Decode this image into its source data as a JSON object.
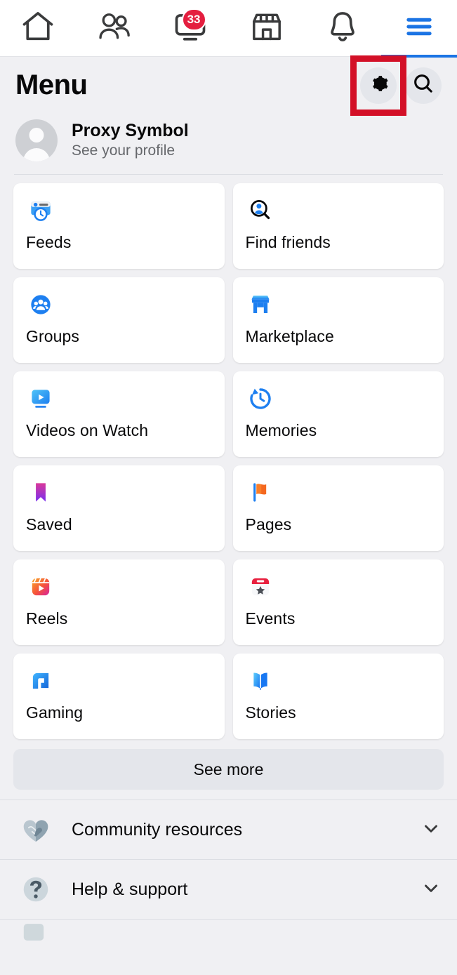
{
  "topnav": {
    "tabs": [
      {
        "name": "home",
        "icon": "home-icon",
        "badge": null,
        "active": false
      },
      {
        "name": "friends",
        "icon": "friends-icon",
        "badge": null,
        "active": false
      },
      {
        "name": "video",
        "icon": "video-icon",
        "badge": "33",
        "active": false
      },
      {
        "name": "marketplace",
        "icon": "marketplace-icon",
        "badge": null,
        "active": false
      },
      {
        "name": "notifications",
        "icon": "bell-icon",
        "badge": null,
        "active": false
      },
      {
        "name": "menu",
        "icon": "hamburger-icon",
        "badge": null,
        "active": true
      }
    ]
  },
  "header": {
    "title": "Menu",
    "settings_icon": "gear-icon",
    "search_icon": "search-icon",
    "highlight_color": "#d31027",
    "active_tab_color": "#1b74e4"
  },
  "profile": {
    "name": "Proxy Symbol",
    "subtitle": "See your profile",
    "avatar_icon": "default-avatar-icon"
  },
  "tiles": [
    {
      "label": "Feeds",
      "icon": "feeds-icon"
    },
    {
      "label": "Find friends",
      "icon": "find-friends-icon"
    },
    {
      "label": "Groups",
      "icon": "groups-icon"
    },
    {
      "label": "Marketplace",
      "icon": "marketplace-icon"
    },
    {
      "label": "Videos on Watch",
      "icon": "videos-on-watch-icon"
    },
    {
      "label": "Memories",
      "icon": "memories-icon"
    },
    {
      "label": "Saved",
      "icon": "saved-icon"
    },
    {
      "label": "Pages",
      "icon": "pages-icon"
    },
    {
      "label": "Reels",
      "icon": "reels-icon"
    },
    {
      "label": "Events",
      "icon": "events-icon"
    },
    {
      "label": "Gaming",
      "icon": "gaming-icon"
    },
    {
      "label": "Stories",
      "icon": "stories-icon"
    }
  ],
  "see_more": {
    "label": "See more"
  },
  "sections": [
    {
      "label": "Community resources",
      "icon": "handshake-heart-icon",
      "chevron": "chevron-down-icon"
    },
    {
      "label": "Help & support",
      "icon": "question-circle-icon",
      "chevron": "chevron-down-icon"
    }
  ]
}
